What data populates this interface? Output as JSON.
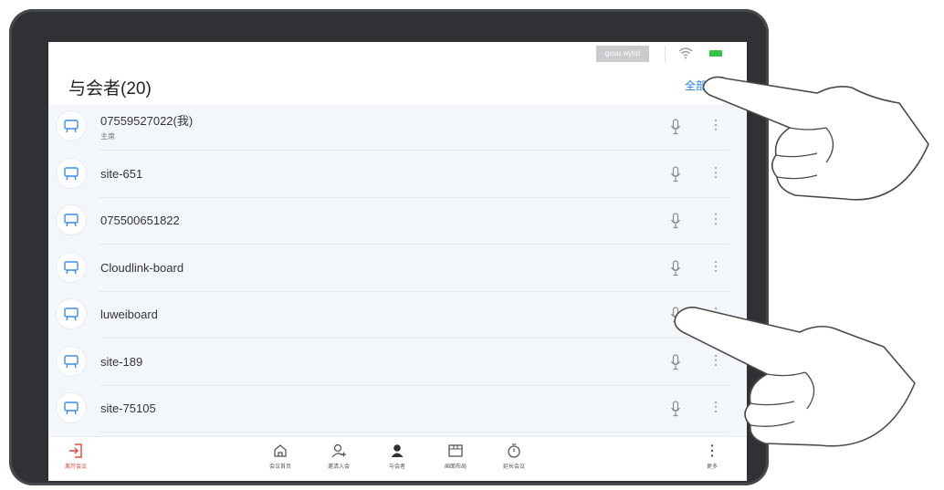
{
  "status": {
    "network_name": "gxuu wyhd"
  },
  "header": {
    "title": "与会者(20)",
    "mute_all_label": "全部静音"
  },
  "participants": [
    {
      "name": "07559527022(我)",
      "role": "主席"
    },
    {
      "name": "site-651",
      "role": ""
    },
    {
      "name": "075500651822",
      "role": ""
    },
    {
      "name": "Cloudlink-board",
      "role": ""
    },
    {
      "name": "luweiboard",
      "role": ""
    },
    {
      "name": "site-189",
      "role": ""
    },
    {
      "name": "site-75105",
      "role": ""
    }
  ],
  "bottom_bar": {
    "leave": "离开会议",
    "home": "会议首页",
    "invite": "邀请入会",
    "participants": "与会者",
    "layout": "画面布局",
    "extend": "延长会议",
    "more": "更多"
  },
  "colors": {
    "accent": "#1f7ee6",
    "leave": "#e0463a",
    "list_bg": "#f3f7fb",
    "battery": "#36c24a"
  }
}
